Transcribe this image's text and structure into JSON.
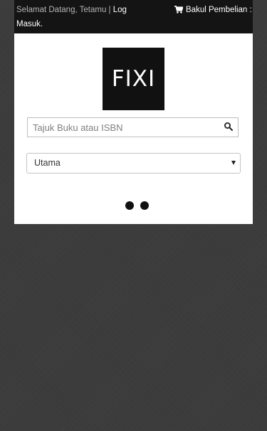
{
  "topbar": {
    "welcome_text": "Selamat Datang, Tetamu | ",
    "login_part1": "Log",
    "login_part2": "Masuk.",
    "cart_label": "Bakul Pembelian :",
    "cart_icon": "cart-icon"
  },
  "logo": {
    "text": "FIXI"
  },
  "search": {
    "placeholder": "Tajuk Buku atau ISBN",
    "value": "",
    "icon": "search-icon"
  },
  "category_select": {
    "selected": "Utama"
  },
  "carousel": {
    "dot_count": 2
  },
  "colors": {
    "background": "#3c3c3c",
    "topbar": "#141414",
    "panel": "#ffffff",
    "logo_bg": "#111111"
  }
}
